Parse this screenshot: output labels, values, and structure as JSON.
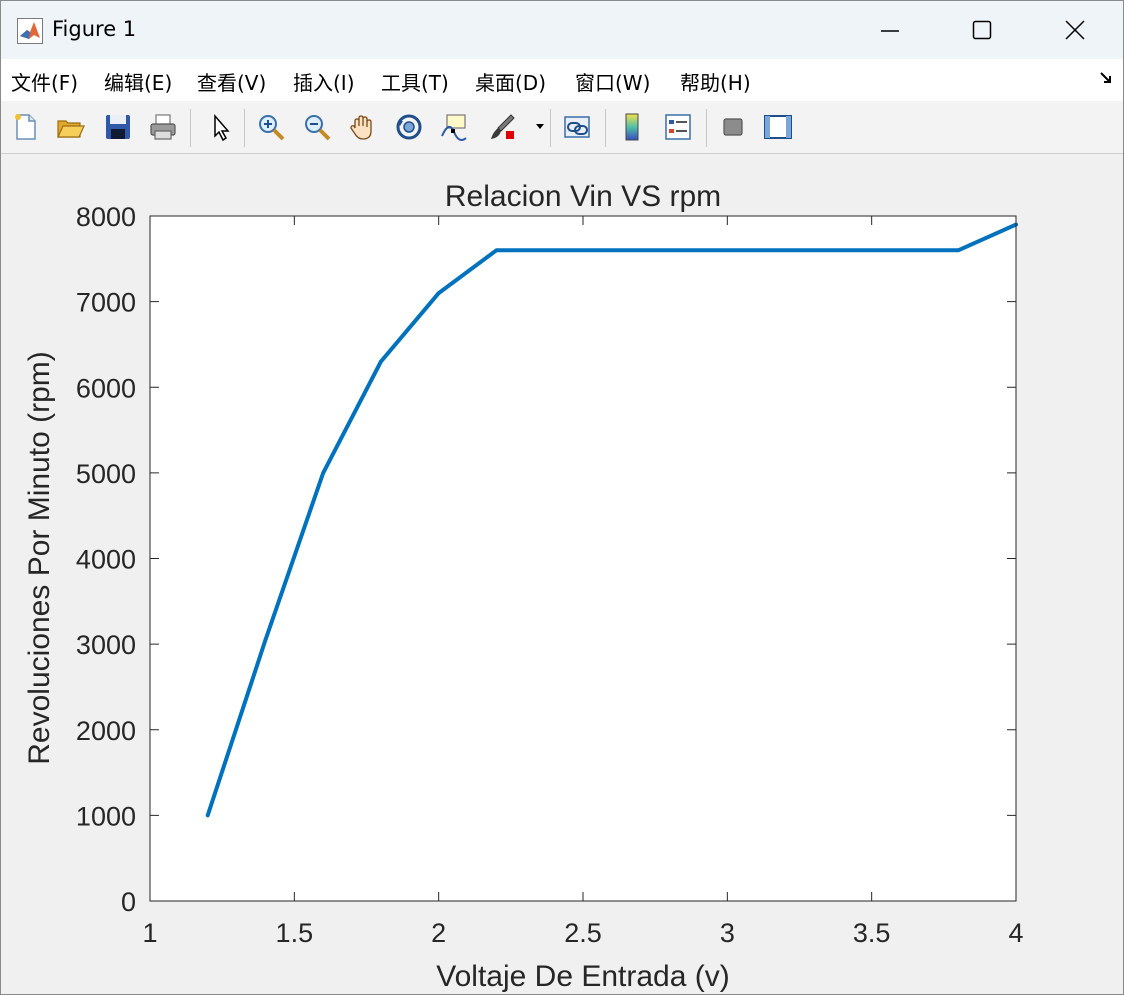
{
  "window": {
    "title": "Figure 1",
    "controls": [
      "minimize",
      "maximize",
      "close"
    ]
  },
  "menu": {
    "items": [
      "文件(F)",
      "编辑(E)",
      "查看(V)",
      "插入(I)",
      "工具(T)",
      "桌面(D)",
      "窗口(W)",
      "帮助(H)"
    ]
  },
  "toolbar": {
    "tools": [
      {
        "name": "new-figure",
        "icon": "new-file-icon"
      },
      {
        "name": "open-file",
        "icon": "folder-open-icon"
      },
      {
        "name": "save",
        "icon": "floppy-icon"
      },
      {
        "name": "print",
        "icon": "printer-icon"
      },
      {
        "name": "edit-plot",
        "icon": "pointer-arrow-icon"
      },
      {
        "name": "zoom-in",
        "icon": "zoom-in-icon"
      },
      {
        "name": "zoom-out",
        "icon": "zoom-out-icon"
      },
      {
        "name": "pan",
        "icon": "hand-icon"
      },
      {
        "name": "rotate-3d",
        "icon": "rotate-icon"
      },
      {
        "name": "data-cursor",
        "icon": "data-tip-icon"
      },
      {
        "name": "brush",
        "icon": "brush-icon"
      },
      {
        "name": "link-plot",
        "icon": "link-plot-icon"
      },
      {
        "name": "colorbar",
        "icon": "colorbar-icon"
      },
      {
        "name": "legend",
        "icon": "legend-icon"
      },
      {
        "name": "hide-plot-tools",
        "icon": "hide-tools-icon"
      },
      {
        "name": "show-plot-tools",
        "icon": "show-tools-icon"
      }
    ]
  },
  "colors": {
    "line": "#0072bd",
    "axes_bg": "#ffffff",
    "figure_bg": "#f0f0f0",
    "text": "#262626"
  },
  "chart_data": {
    "type": "line",
    "title": "Relacion Vin VS rpm",
    "xlabel": "Voltaje De Entrada (v)",
    "ylabel": "Revoluciones Por Minuto (rpm)",
    "xlim": [
      1,
      4
    ],
    "ylim": [
      0,
      8000
    ],
    "xticks": [
      1,
      1.5,
      2,
      2.5,
      3,
      3.5,
      4
    ],
    "xtick_labels": [
      "1",
      "1.5",
      "2",
      "2.5",
      "3",
      "3.5",
      "4"
    ],
    "yticks": [
      0,
      1000,
      2000,
      3000,
      4000,
      5000,
      6000,
      7000,
      8000
    ],
    "ytick_labels": [
      "0",
      "1000",
      "2000",
      "3000",
      "4000",
      "5000",
      "6000",
      "7000",
      "8000"
    ],
    "grid": false,
    "series": [
      {
        "x": [
          1.2,
          1.4,
          1.6,
          1.8,
          2.0,
          2.2,
          2.4,
          2.6,
          2.8,
          3.0,
          3.2,
          3.4,
          3.6,
          3.8,
          4.0
        ],
        "y": [
          1000,
          3050,
          5000,
          6300,
          7100,
          7600,
          7600,
          7600,
          7600,
          7600,
          7600,
          7600,
          7600,
          7600,
          7900
        ]
      }
    ]
  }
}
